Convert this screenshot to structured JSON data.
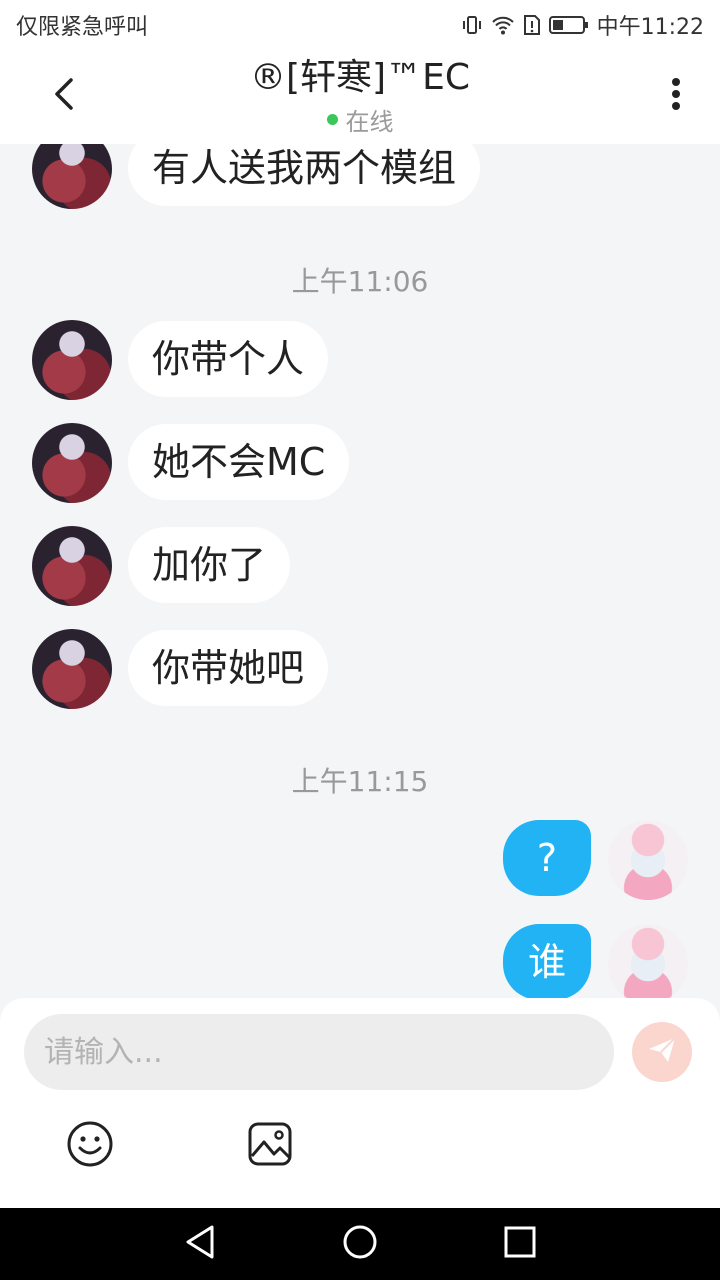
{
  "status_bar": {
    "carrier_text": "仅限紧急呼叫",
    "time": "中午11:22",
    "icons": [
      "vibrate-icon",
      "wifi-icon",
      "sim-alert-icon",
      "battery-icon"
    ]
  },
  "header": {
    "title": "®[轩寒]™EC",
    "status": "在线",
    "status_color": "#3cc65a",
    "back_icon": "chevron-left-icon",
    "more_icon": "more-vertical-icon"
  },
  "messages": [
    {
      "type": "incoming",
      "text": "有人送我两个模组"
    },
    {
      "type": "timestamp",
      "text": "上午11:06"
    },
    {
      "type": "incoming",
      "text": "你带个人"
    },
    {
      "type": "incoming",
      "text": "她不会MC"
    },
    {
      "type": "incoming",
      "text": "加你了"
    },
    {
      "type": "incoming",
      "text": "你带她吧"
    },
    {
      "type": "timestamp",
      "text": "上午11:15"
    },
    {
      "type": "outgoing",
      "text": "?"
    },
    {
      "type": "outgoing",
      "text": "谁"
    }
  ],
  "composer": {
    "placeholder": "请输入...",
    "value": "",
    "send_icon": "send-icon",
    "emoji_icon": "emoji-icon",
    "image_icon": "image-icon"
  },
  "nav_bar": {
    "buttons": [
      "back-triangle-icon",
      "home-circle-icon",
      "recents-square-icon"
    ]
  },
  "colors": {
    "accent": "#22b3f5",
    "background": "#f4f5f7",
    "send_button": "#fbd6cf"
  }
}
